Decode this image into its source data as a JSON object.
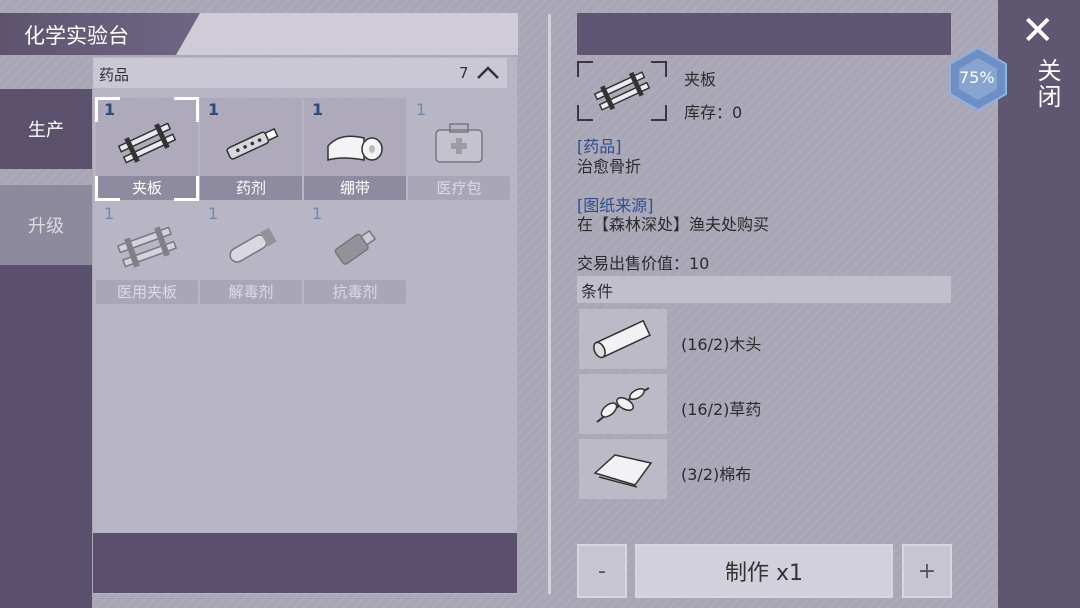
{
  "header": {
    "title": "化学实验台"
  },
  "tabs": [
    {
      "label": "生产",
      "active": true
    },
    {
      "label": "升级",
      "active": false
    }
  ],
  "section": {
    "title": "药品",
    "count": "7"
  },
  "items": [
    {
      "qty": "1",
      "label": "夹板",
      "icon": "splint-icon",
      "selected": true,
      "available": true
    },
    {
      "qty": "1",
      "label": "药剂",
      "icon": "medicine-icon",
      "selected": false,
      "available": true
    },
    {
      "qty": "1",
      "label": "绷带",
      "icon": "bandage-icon",
      "selected": false,
      "available": true
    },
    {
      "qty": "1",
      "label": "医疗包",
      "icon": "medkit-icon",
      "selected": false,
      "available": false
    },
    {
      "qty": "1",
      "label": "医用夹板",
      "icon": "medical-splint-icon",
      "selected": false,
      "available": false
    },
    {
      "qty": "1",
      "label": "解毒剂",
      "icon": "antidote-icon",
      "selected": false,
      "available": false
    },
    {
      "qty": "1",
      "label": "抗毒剂",
      "icon": "antivenom-icon",
      "selected": false,
      "available": false
    }
  ],
  "detail": {
    "name": "夹板",
    "stock": "库存：0",
    "category_tag": "[药品]",
    "category_desc": "治愈骨折",
    "source_tag": "[图纸来源]",
    "source_desc": "在【森林深处】渔夫处购买",
    "sell_value": "交易出售价值：10",
    "conditions_title": "条件",
    "materials": [
      {
        "text": "(16/2)木头",
        "icon": "wood-log-icon"
      },
      {
        "text": "(16/2)草药",
        "icon": "herb-icon"
      },
      {
        "text": "(3/2)棉布",
        "icon": "cotton-cloth-icon"
      }
    ]
  },
  "controls": {
    "minus": "-",
    "make": "制作 x1",
    "plus": "+"
  },
  "side": {
    "close_icon": "✕",
    "close_label": "关闭",
    "progress": "75%"
  },
  "colors": {
    "accent": "#5f5672",
    "qty_blue": "#2d4a7a",
    "tag_blue": "#2d4f8e"
  }
}
